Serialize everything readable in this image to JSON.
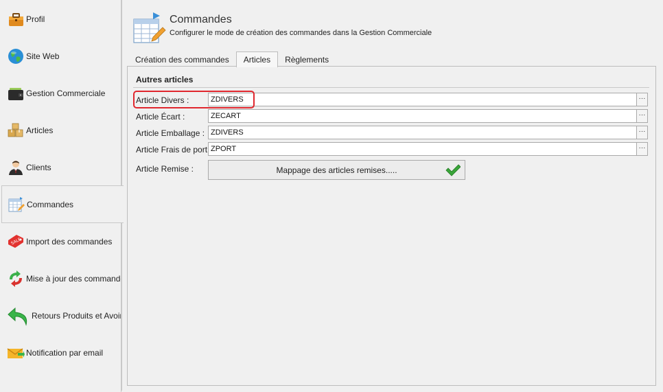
{
  "sidebar": {
    "items": [
      {
        "label": "Profil",
        "icon": "briefcase-icon"
      },
      {
        "label": "Site Web",
        "icon": "globe-icon"
      },
      {
        "label": "Gestion Commerciale",
        "icon": "wallet-icon"
      },
      {
        "label": "Articles",
        "icon": "boxes-icon"
      },
      {
        "label": "Clients",
        "icon": "user-icon"
      },
      {
        "label": "Commandes",
        "icon": "order-sheet-icon"
      },
      {
        "label": "Import des commandes",
        "icon": "sale-tag-icon"
      },
      {
        "label": "Mise à jour des commandes",
        "icon": "refresh-arrows-icon"
      },
      {
        "label": "Retours Produits et Avoirs",
        "icon": "return-arrow-icon"
      },
      {
        "label": "Notification par email",
        "icon": "email-icon"
      }
    ],
    "active_index": 5
  },
  "header": {
    "title": "Commandes",
    "subtitle": "Configurer le mode de création des commandes dans la Gestion Commerciale"
  },
  "tabs": [
    {
      "label": "Création des commandes"
    },
    {
      "label": "Articles"
    },
    {
      "label": "Règlements"
    }
  ],
  "active_tab": 1,
  "group": {
    "title": "Autres articles",
    "fields": [
      {
        "label": "Article Divers :",
        "value": "ZDIVERS"
      },
      {
        "label": "Article Écart :",
        "value": "ZECART"
      },
      {
        "label": "Article Emballage :",
        "value": "ZDIVERS"
      },
      {
        "label": "Article Frais de port :",
        "value": "ZPORT"
      }
    ],
    "dots_label": "···",
    "remise_label": "Article Remise :",
    "mapping_button": "Mappage des articles remises....."
  },
  "colors": {
    "highlight": "#e0262d",
    "check": "#3aa53a"
  }
}
